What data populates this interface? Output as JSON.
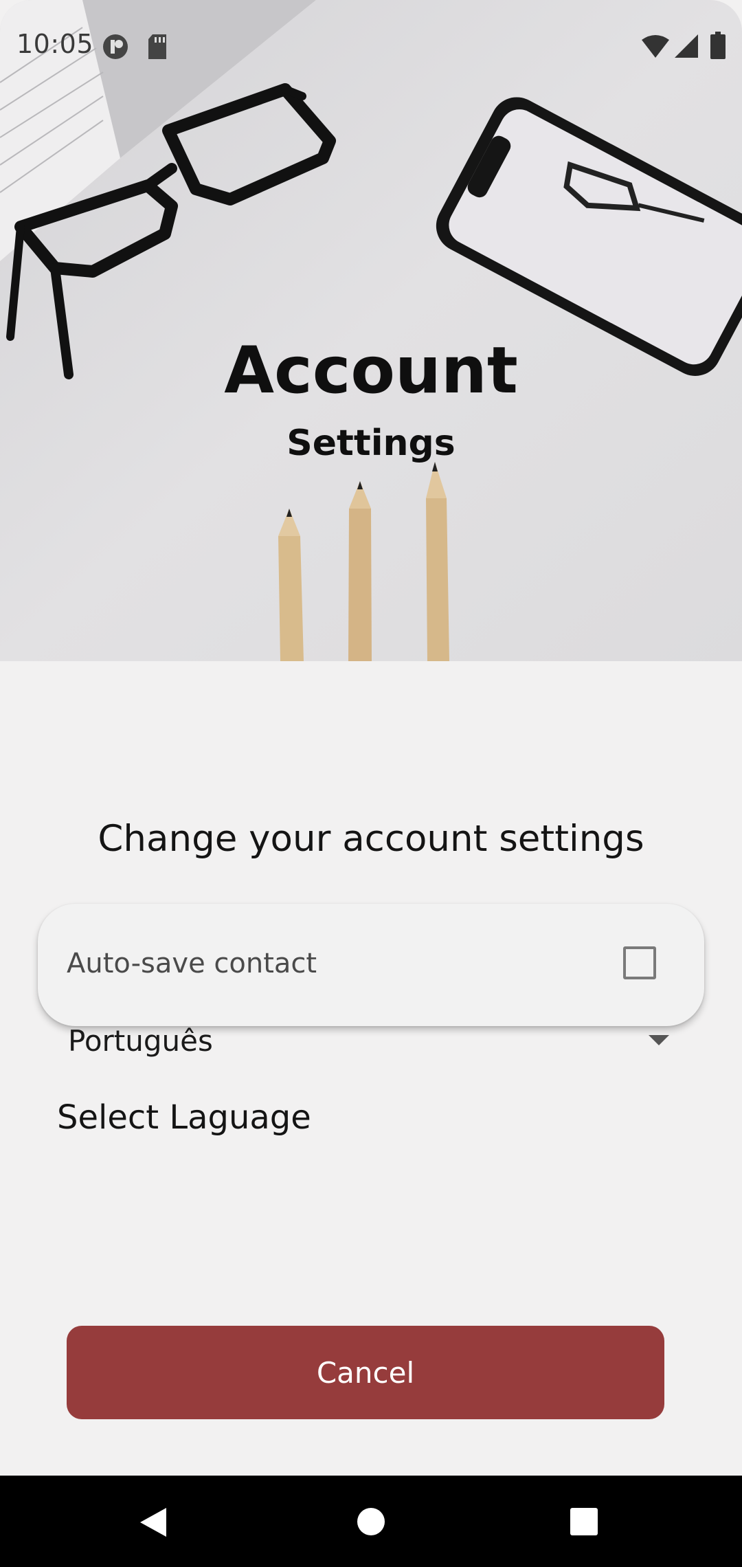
{
  "status_bar": {
    "time": "10:05",
    "left_icons": [
      "app-notification-icon",
      "sd-card-icon"
    ],
    "right_icons": [
      "wifi-icon",
      "cellular-signal-icon",
      "battery-icon"
    ]
  },
  "hero": {
    "title": "Account",
    "subtitle": "Settings",
    "background": "desk-photo-glasses-phone-pencils"
  },
  "main": {
    "heading": "Change your account settings",
    "auto_save": {
      "label": "Auto-save contact",
      "checked": false
    },
    "language": {
      "selected": "Português",
      "label": "Select Laguage"
    },
    "cancel_button": "Cancel"
  },
  "navigation": {
    "buttons": [
      "back-icon",
      "home-icon",
      "recents-icon"
    ]
  },
  "colors": {
    "accent": "#963c3c",
    "background": "#f2f1f1",
    "nav_bar": "#000000"
  }
}
